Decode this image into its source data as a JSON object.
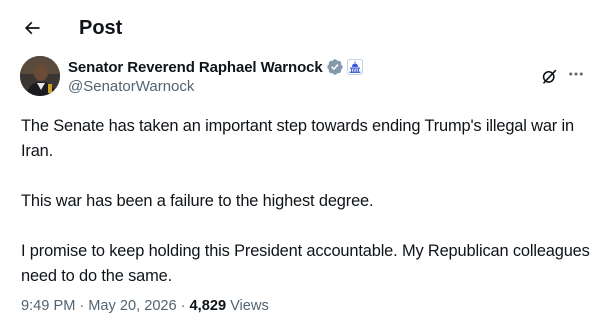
{
  "header": {
    "back_icon": "arrow-left-icon",
    "title": "Post"
  },
  "author": {
    "display_name": "Senator Reverend Raphael Warnock",
    "handle": "@SenatorWarnock",
    "verified_icon": "gray-verified-badge-icon",
    "affiliation_icon": "us-capitol-affiliation-icon",
    "grok_icon": "grok-icon",
    "more_icon": "more-horizontal-icon"
  },
  "tweet": {
    "paragraphs": [
      "The Senate has taken an important step towards ending Trump's illegal war in Iran.",
      "This war has been a failure to the highest degree.",
      "I promise to keep holding this President accountable. My Republican colleagues need to do the same."
    ]
  },
  "meta": {
    "time": "9:49 PM",
    "separator": "·",
    "date": "May 20, 2026",
    "views_count": "4,829",
    "views_label": "Views"
  },
  "colors": {
    "text": "#0f1419",
    "secondary": "#536471",
    "verified_gray": "#829aab",
    "affiliation_blue": "#3b5bdb"
  }
}
